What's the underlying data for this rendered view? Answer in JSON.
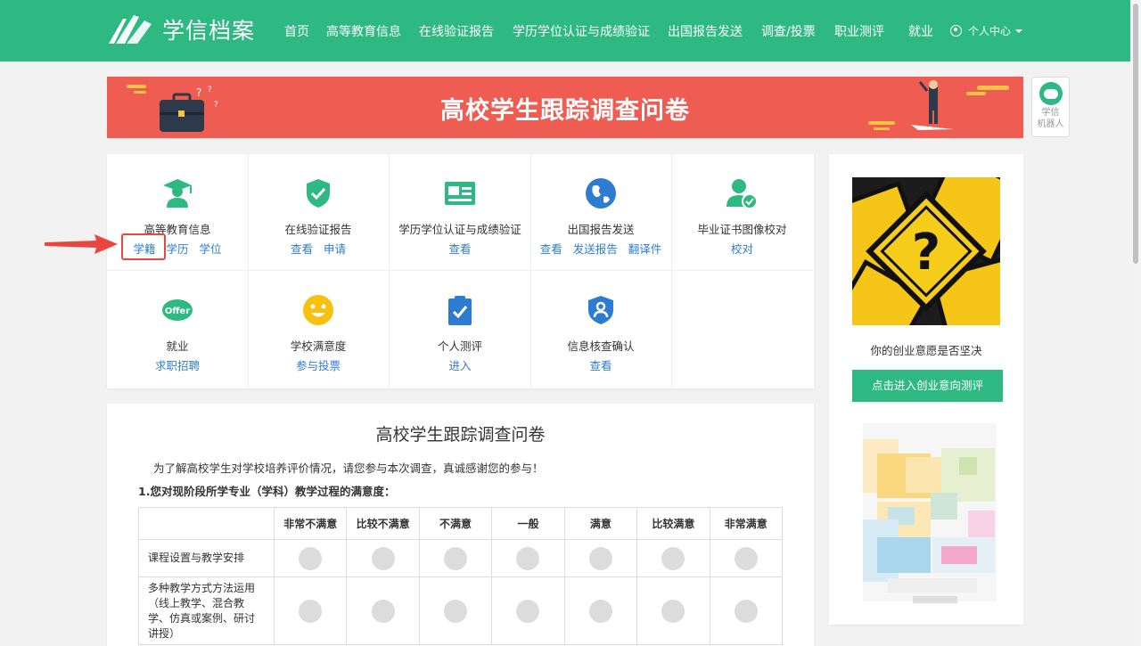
{
  "header": {
    "logo_text": "学信档案",
    "nav": [
      "首页",
      "高等教育信息",
      "在线验证报告",
      "学历学位认证与成绩验证",
      "出国报告发送",
      "调查/投票",
      "职业测评",
      "就业"
    ],
    "user_menu": "个人中心"
  },
  "banner": {
    "title": "高校学生跟踪调查问卷"
  },
  "robot": {
    "line1": "学信",
    "line2": "机器人"
  },
  "services": [
    {
      "title": "高等教育信息",
      "icon": "graduate-icon",
      "links": [
        "学籍",
        "学历",
        "学位"
      ]
    },
    {
      "title": "在线验证报告",
      "icon": "shield-check-icon",
      "links": [
        "查看",
        "申请"
      ]
    },
    {
      "title": "学历学位认证与成绩验证",
      "icon": "id-card-icon",
      "links": [
        "查看"
      ]
    },
    {
      "title": "出国报告发送",
      "icon": "globe-icon",
      "links": [
        "查看",
        "发送报告",
        "翻译件"
      ]
    },
    {
      "title": "毕业证书图像校对",
      "icon": "user-check-icon",
      "links": [
        "校对"
      ]
    },
    {
      "title": "就业",
      "icon": "offer-icon",
      "links": [
        "求职招聘"
      ]
    },
    {
      "title": "学校满意度",
      "icon": "smile-icon",
      "links": [
        "参与投票"
      ]
    },
    {
      "title": "个人测评",
      "icon": "clipboard-check-icon",
      "links": [
        "进入"
      ]
    },
    {
      "title": "信息核查确认",
      "icon": "shield-user-icon",
      "links": [
        "查看"
      ]
    }
  ],
  "colors": {
    "brand": "#2eb882",
    "banner": "#ef5c52",
    "link": "#2d7cd1",
    "highlight": "#e8463e"
  },
  "survey": {
    "title": "高校学生跟踪调查问卷",
    "intro": "为了解高校学生对学校培养评价情况，请您参与本次调查，真诚感谢您的参与！",
    "question": "1.您对现阶段所学专业（学科）教学过程的满意度：",
    "columns": [
      "非常不满意",
      "比较不满意",
      "不满意",
      "一般",
      "满意",
      "比较满意",
      "非常满意"
    ],
    "rows": [
      {
        "label": "课程设置与教学安排"
      },
      {
        "label": "多种教学方式方法运用（线上教学、混合教学、仿真或案例、研讨讲授）"
      }
    ]
  },
  "ad": {
    "caption": "你的创业意愿是否坚决",
    "button": "点击进入创业意向测评"
  }
}
